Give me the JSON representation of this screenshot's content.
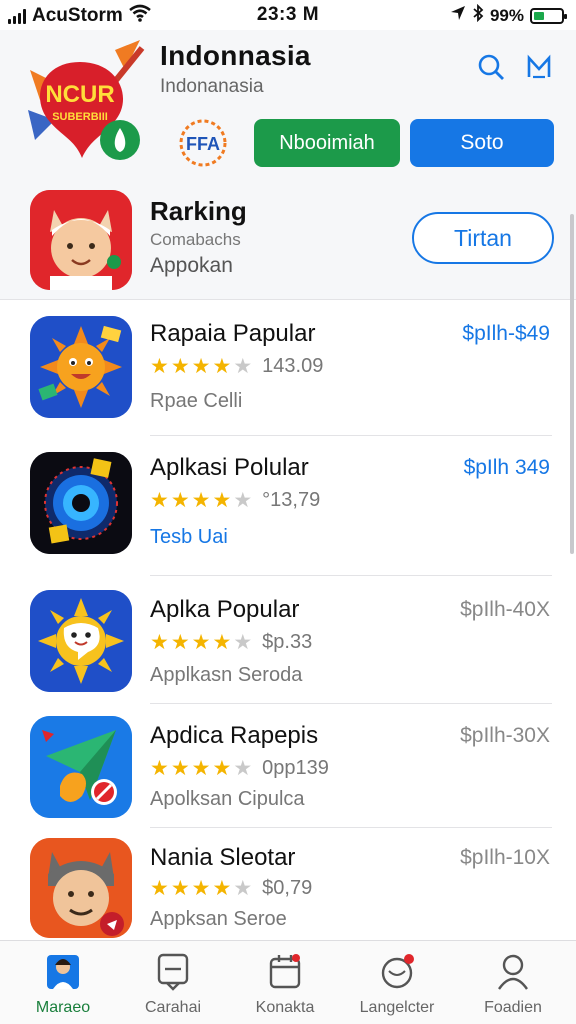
{
  "status_bar": {
    "carrier": "AcuStorm",
    "time": "23:3 M",
    "battery": "99%"
  },
  "header": {
    "title": "Indonnasia",
    "subtitle": "Indonanasia",
    "logo_text": "NCUR",
    "logo_subtext": "SUBERBIII",
    "small_logo_text": "FFA",
    "green_button": "Nbooimiah",
    "blue_button": "Soto"
  },
  "ranking": {
    "title": "Rarking",
    "subtitle": "Comabachs",
    "sub2": "Appokan",
    "button": "Tirtan"
  },
  "apps": [
    {
      "name": "Rapaia Papular",
      "rating": "143.09",
      "stars": 4.5,
      "category": "Rpae Celli",
      "category_link": false,
      "price": "$pIlh-$49",
      "price_muted": false
    },
    {
      "name": "Aplkasi Polular",
      "rating": "°13,79",
      "stars": 4.5,
      "category": "Tesb Uai",
      "category_link": true,
      "price": "$pIlh 349",
      "price_muted": false
    },
    {
      "name": "Aplka Popular",
      "rating": "$p.33",
      "stars": 4.5,
      "category": "Applkasn Seroda",
      "category_link": false,
      "price": "$pIlh-40X",
      "price_muted": true
    },
    {
      "name": "Apdica Rapepis",
      "rating": "0pp139",
      "stars": 4.5,
      "category": "Apolksan Cipulca",
      "category_link": false,
      "price": "$pIlh-30X",
      "price_muted": true
    },
    {
      "name": "Nania Sleotar",
      "rating": "$0,79",
      "stars": 4.5,
      "category": "Appksan Seroe",
      "category_link": false,
      "price": "$pIlh-10X",
      "price_muted": true
    }
  ],
  "tabs": [
    {
      "label": "Maraeo"
    },
    {
      "label": "Carahai"
    },
    {
      "label": "Konakta"
    },
    {
      "label": "Langelcter"
    },
    {
      "label": "Foadien"
    }
  ],
  "colors": {
    "accent": "#1677e5",
    "green": "#1c9a4a",
    "star": "#f4b400"
  }
}
